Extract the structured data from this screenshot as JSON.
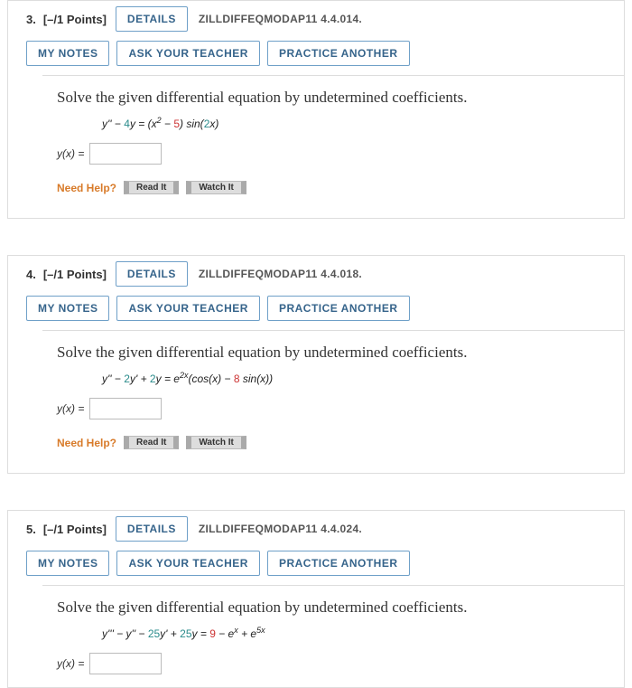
{
  "buttons": {
    "details": "DETAILS",
    "my_notes": "MY NOTES",
    "ask_teacher": "ASK YOUR TEACHER",
    "practice_another": "PRACTICE ANOTHER"
  },
  "help": {
    "label": "Need Help?",
    "read": "Read It",
    "watch": "Watch It"
  },
  "prompt": "Solve the given differential equation by undetermined coefficients.",
  "answer_label": "y(x) =",
  "questions": [
    {
      "num": "3.",
      "points": "[–/1 Points]",
      "source": "ZILLDIFFEQMODAP11 4.4.014.",
      "eq": {
        "lhs_a": "y'' − ",
        "coef1": "4",
        "mid1": "y = (x",
        "sup1": "2",
        "mid2": " − ",
        "coef2": "5",
        "mid3": ") sin(",
        "coef3": "2",
        "tail": "x)"
      }
    },
    {
      "num": "4.",
      "points": "[–/1 Points]",
      "source": "ZILLDIFFEQMODAP11 4.4.018.",
      "eq": {
        "lhs_a": "y'' − ",
        "coef1": "2",
        "mid1": "y' + ",
        "coef2": "2",
        "mid2": "y = e",
        "sup1": "2x",
        "mid3": "(cos(x) − ",
        "coef3": "8",
        "tail": " sin(x))"
      }
    },
    {
      "num": "5.",
      "points": "[–/1 Points]",
      "source": "ZILLDIFFEQMODAP11 4.4.024.",
      "eq": {
        "lhs_a": "y''' − y'' − ",
        "coef1": "25",
        "mid1": "y' + ",
        "coef2": "25",
        "mid2": "y = ",
        "coef3": "9",
        "mid3": " − e",
        "sup1": "x",
        "mid4": " + e",
        "sup2": "5x"
      }
    }
  ]
}
